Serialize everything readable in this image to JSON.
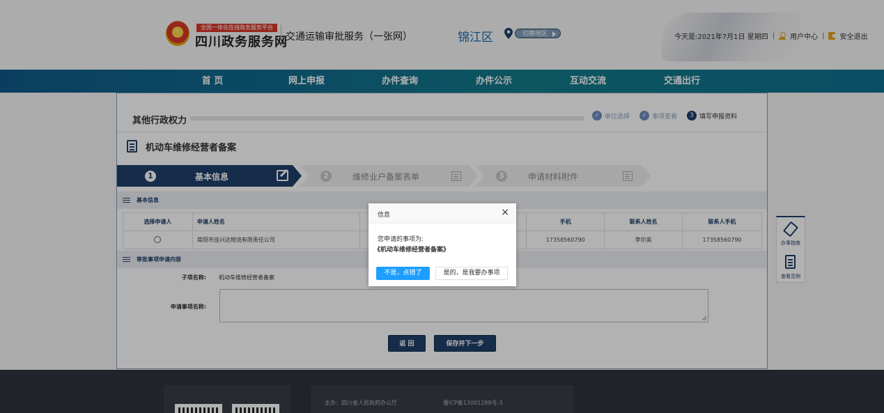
{
  "header": {
    "site_banner": "全国一体化在线政务服务平台",
    "site_name": "四川政务服务网",
    "service_name": "交通运输审批服务（一张网）",
    "region": "锦江区",
    "switch_region": "切换地区",
    "date_text": "今天是:2021年7月1日 星期四",
    "user_center": "用户中心",
    "logout": "安全退出"
  },
  "nav": {
    "items": [
      "首 页",
      "网上申报",
      "办件查询",
      "办件公示",
      "互动交流",
      "交通出行"
    ]
  },
  "main": {
    "title": "其他行政权力",
    "progress_steps": [
      {
        "label": "单位选择",
        "mark": "✓",
        "state": "done"
      },
      {
        "label": "事项查看",
        "mark": "✓",
        "state": "done"
      },
      {
        "label": "填写申报资料",
        "mark": "3",
        "state": "active"
      }
    ],
    "matter_name": "机动车维修经营者备案",
    "wizard": [
      {
        "num": "1",
        "label": "基本信息",
        "active": true
      },
      {
        "num": "2",
        "label": "维修业户备案表单",
        "active": false
      },
      {
        "num": "3",
        "label": "申请材料附件",
        "active": false
      }
    ],
    "section_basic": "基本信息",
    "table": {
      "headers": [
        "选择申请人",
        "申请人姓名",
        "",
        "手机",
        "联系人姓名",
        "联系人手机"
      ],
      "rows": [
        {
          "name": "简阳市佳兴达物流有限责任公司",
          "mobile": "17358560790",
          "contact": "李尔英",
          "contact_mobile": "17358560790"
        }
      ]
    },
    "section_matter": "审批事项申请内容",
    "sub_item_label": "子项名称:",
    "sub_item_value": "机动车维修经营者备案",
    "apply_name_label": "申请事项名称:",
    "apply_name_value": "",
    "back_button": "返 回",
    "save_next_button": "保存并下一步"
  },
  "side_tools": {
    "guide": "办事指南",
    "sample": "查看范例"
  },
  "footer": {
    "sponsor": "主办：四川省人民政府办公厅",
    "icp": "蜀ICP备13001288号-3"
  },
  "dialog": {
    "title": "信息",
    "close": "×",
    "message": "您申请的事项为:",
    "matter": "《机动车维修经营者备案》",
    "no_button": "不是，点错了",
    "yes_button": "是的，是我要办事项"
  },
  "colors": {
    "nav_bg": "#116a8e",
    "primary": "#1f3f6b",
    "dialog_primary": "#1e9fff",
    "banner_red": "#d8392a"
  }
}
